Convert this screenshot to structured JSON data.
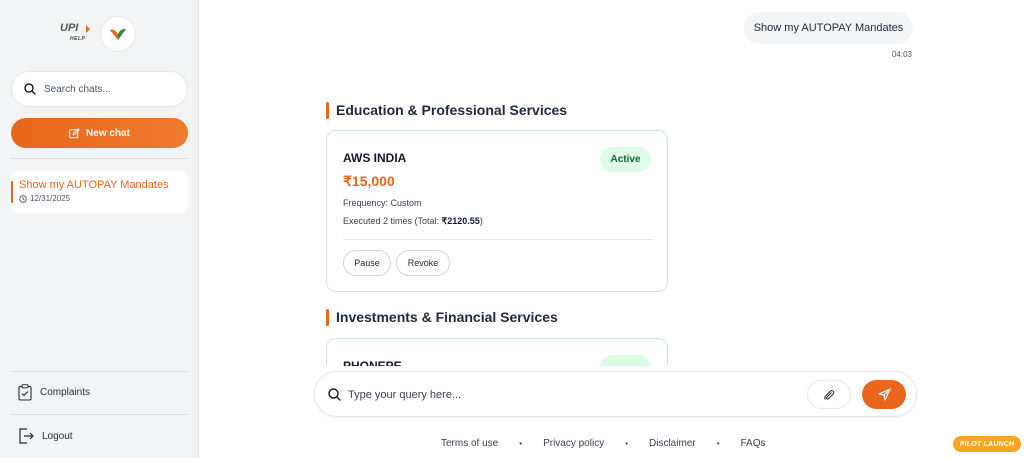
{
  "sidebar": {
    "logo_text": "UPI",
    "logo_subtext": "HELP",
    "search_placeholder": "Search chats...",
    "new_chat_label": "New chat",
    "history": [
      {
        "title": "Show my AUTOPAY Mandates",
        "date": "12/31/2025"
      }
    ],
    "complaints_label": "Complaints",
    "logout_label": "Logout"
  },
  "chat": {
    "user_message": "Show my AUTOPAY Mandates",
    "user_message_time": "04:03",
    "sections": [
      {
        "title": "Education & Professional Services",
        "mandate": {
          "merchant": "AWS INDIA",
          "status": "Active",
          "amount": "₹15,000",
          "frequency": "Frequency: Custom",
          "executed_prefix": "Executed 2 times (Total: ",
          "executed_total": "₹2120.55",
          "executed_suffix": ")",
          "pause_label": "Pause",
          "revoke_label": "Revoke"
        }
      },
      {
        "title": "Investments & Financial Services",
        "mandate": {
          "merchant": "PHONEPE"
        }
      }
    ]
  },
  "composer": {
    "placeholder": "Type your query here..."
  },
  "footer": {
    "links": [
      "Terms of use",
      "Privacy policy",
      "Disclaimer",
      "FAQs"
    ],
    "pilot_badge": "PILOT LAUNCH"
  },
  "colors": {
    "accent": "#e9661c",
    "active_badge_bg": "#dcfce7",
    "active_badge_text": "#166534"
  }
}
